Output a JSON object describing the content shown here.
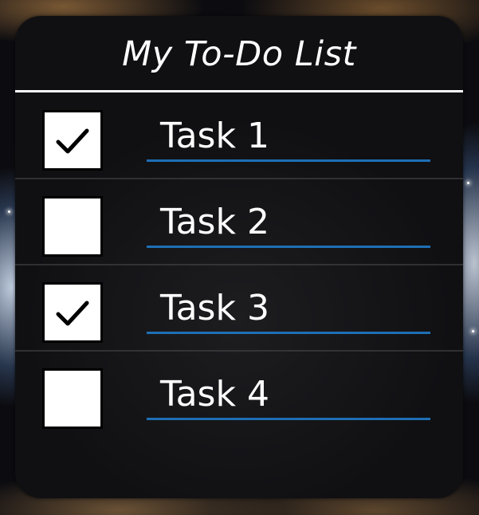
{
  "app": {
    "title": "My To-Do List"
  },
  "tasks": [
    {
      "label": "Task 1",
      "checked": true
    },
    {
      "label": "Task 2",
      "checked": false
    },
    {
      "label": "Task 3",
      "checked": true
    },
    {
      "label": "Task 4",
      "checked": false
    }
  ],
  "colors": {
    "accent_underline": "#1e6fb4",
    "card_background": "#141416",
    "text": "#ffffff"
  },
  "icons": {
    "checked": "checkmark-icon"
  }
}
